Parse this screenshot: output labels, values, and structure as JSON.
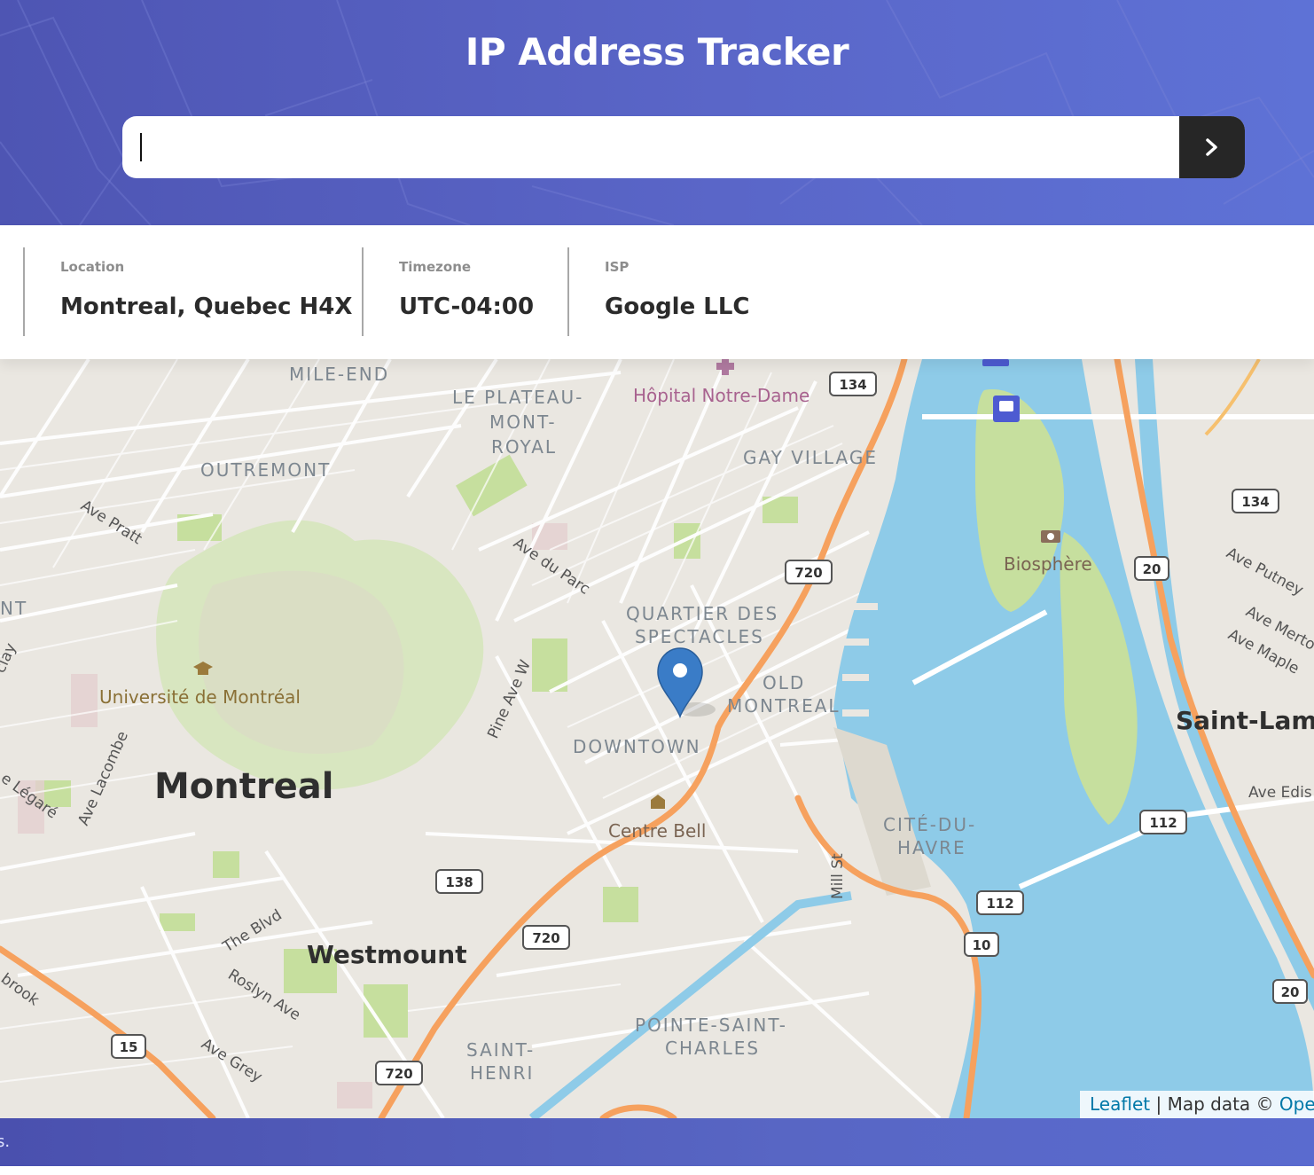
{
  "header": {
    "title": "IP Address Tracker",
    "search": {
      "value": "",
      "placeholder": ""
    },
    "submit_icon": "chevron-right-icon"
  },
  "info": {
    "location": {
      "label": "Location",
      "value": "Montreal, Quebec H4X"
    },
    "timezone": {
      "label": "Timezone",
      "value": "UTC-04:00"
    },
    "isp": {
      "label": "ISP",
      "value": "Google LLC"
    }
  },
  "map": {
    "marker_icon": "map-marker-icon",
    "place_labels": {
      "mile_end": "MILE-END",
      "plateau_line1": "LE PLATEAU-",
      "plateau_line2": "MONT-",
      "plateau_line3": "ROYAL",
      "hopital": "Hôpital Notre-Dame",
      "gay_village": "GAY VILLAGE",
      "outremont": "OUTREMONT",
      "ave_pratt": "Ave Pratt",
      "ave_du_parc": "Ave du Parc",
      "quartier_line1": "QUARTIER DES",
      "quartier_line2": "SPECTACLES",
      "biosphere": "Biosphère",
      "ave_putney": "Ave Putney",
      "ave_merton": "Ave Merto",
      "ave_maple": "Ave Maple",
      "universite": "Université de Montréal",
      "old_line1": "OLD",
      "old_line2": "MONTREAL",
      "saint_lambert": "Saint-Lamb",
      "downtown": "DOWNTOWN",
      "montreal": "Montreal",
      "pine_ave": "Pine Ave W",
      "ave_lacombe": "Ave Lacombe",
      "legare": "e Légaré",
      "nt": "NT",
      "clay": "clay",
      "ave_edison": "Ave Edis",
      "centre_bell": "Centre Bell",
      "cite_line1": "CITÉ-DU-",
      "cite_line2": "HAVRE",
      "mill_st": "Mill St",
      "the_blvd": "The Blvd",
      "westmount": "Westmount",
      "roslyn": "Roslyn Ave",
      "ave_grey": "Ave Grey",
      "brook": "brook",
      "pointe_line1": "POINTE-SAINT-",
      "pointe_line2": "CHARLES",
      "saint_henri_line1": "SAINT-",
      "saint_henri_line2": "HENRI"
    },
    "route_shields": {
      "r134a": "134",
      "r134b": "134",
      "r720a": "720",
      "r20a": "20",
      "r112a": "112",
      "r138": "138",
      "r112b": "112",
      "r10": "10",
      "r720b": "720",
      "r15": "15",
      "r720c": "720",
      "r20b": "20"
    },
    "attribution": {
      "leaflet": "Leaflet",
      "separator": " | ",
      "map_data": "Map data © ",
      "osm": "Oper"
    }
  },
  "footer": {
    "text": "s."
  },
  "colors": {
    "header_bg": "#5663c4",
    "button_bg": "#262626",
    "water": "#8ecbe8",
    "highway": "#f6a15e",
    "park": "#cfe3b0",
    "marker": "#3a7cc7"
  }
}
